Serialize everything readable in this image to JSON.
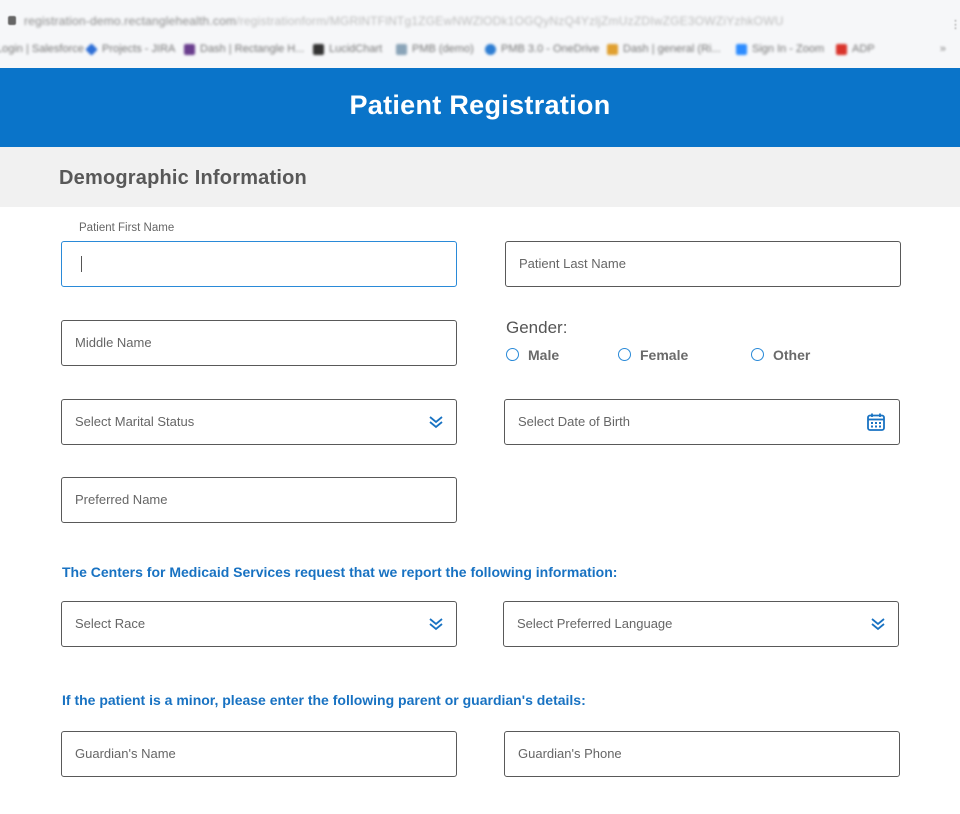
{
  "browser": {
    "url_host": "registration-demo.rectanglehealth.com",
    "url_path": "/registrationform/MGRlNTFlNTg1ZGEwNWZlODk1OGQyNzQ4YzljZmUzZDIwZGE3OWZiYzhkOWU",
    "bookmarks": [
      {
        "label": "Login | Salesforce",
        "color": "#4aa3df"
      },
      {
        "label": "Projects - JIRA",
        "color": "#2e6fd6"
      },
      {
        "label": "Dash | Rectangle H...",
        "color": "#6a3e8e"
      },
      {
        "label": "LucidChart",
        "color": "#333333"
      },
      {
        "label": "PMB (demo)",
        "color": "#8aa4b8"
      },
      {
        "label": "PMB 3.0 - OneDrive",
        "color": "#2d7dd2"
      },
      {
        "label": "Dash | general (Ri...",
        "color": "#e0a030"
      },
      {
        "label": "Sign In - Zoom",
        "color": "#2d8cff"
      },
      {
        "label": "ADP",
        "color": "#d9342b"
      }
    ],
    "more_label": "»"
  },
  "header": {
    "title": "Patient Registration"
  },
  "section": {
    "title": "Demographic Information"
  },
  "fields": {
    "first_name": {
      "label": "Patient First Name",
      "value": ""
    },
    "last_name": {
      "placeholder": "Patient Last Name"
    },
    "middle_name": {
      "placeholder": "Middle Name"
    },
    "marital_status": {
      "placeholder": "Select Marital Status"
    },
    "date_of_birth": {
      "placeholder": "Select Date of Birth"
    },
    "preferred_name": {
      "placeholder": "Preferred Name"
    },
    "race": {
      "placeholder": "Select Race"
    },
    "preferred_language": {
      "placeholder": "Select Preferred Language"
    },
    "guardian_name": {
      "placeholder": "Guardian's Name"
    },
    "guardian_phone": {
      "placeholder": "Guardian's Phone"
    }
  },
  "gender": {
    "label": "Gender:",
    "options": [
      "Male",
      "Female",
      "Other"
    ]
  },
  "notices": {
    "cms": "The Centers for Medicaid Services request that we report the following information:",
    "minor": "If the patient is a minor, please enter the following parent or guardian's details:"
  },
  "colors": {
    "brand_blue": "#0a74c9",
    "accent_blue": "#2a8ad8",
    "notice_blue": "#1872c2",
    "section_bg": "#f1f1f1"
  },
  "icons": {
    "select_chevron": "double-chevron-down-icon",
    "date_picker": "calendar-icon",
    "secure": "lock-icon"
  }
}
